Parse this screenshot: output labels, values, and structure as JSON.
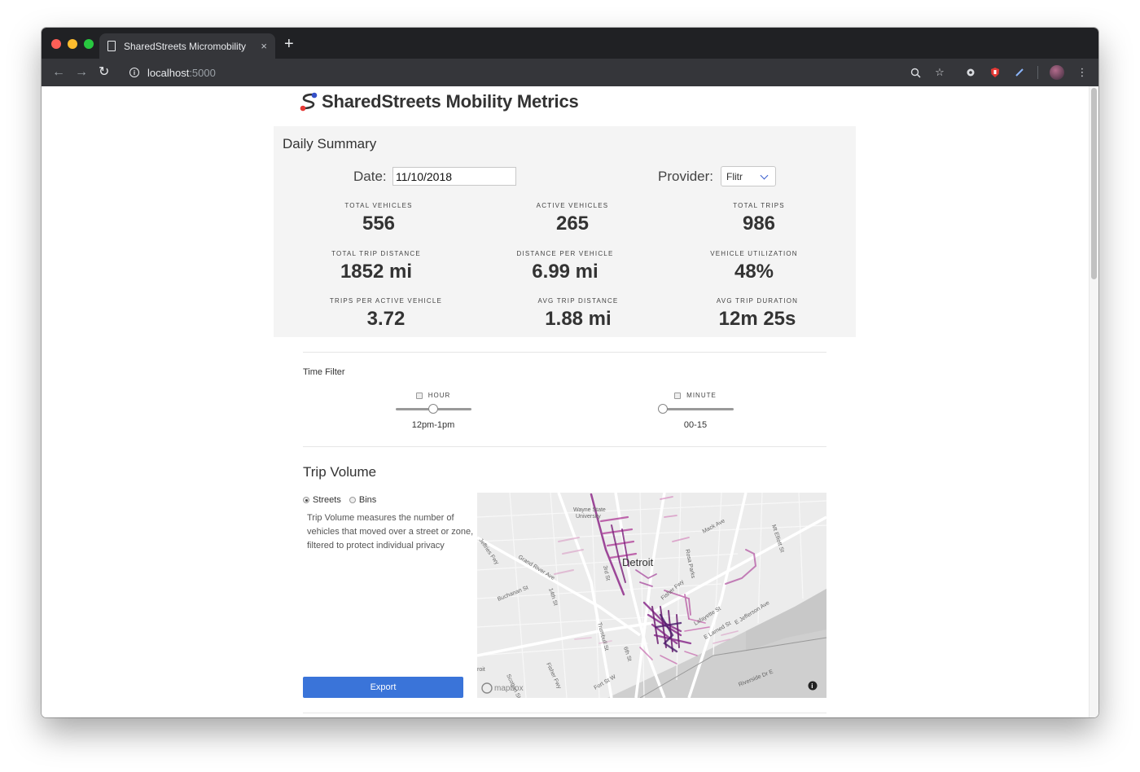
{
  "browser": {
    "tab_title": "SharedStreets Micromobility",
    "tab_close": "×",
    "new_tab": "+",
    "url_host": "localhost",
    "url_port": ":5000"
  },
  "brand": {
    "title": "SharedStreets Mobility Metrics"
  },
  "summary": {
    "title": "Daily Summary",
    "date_label": "Date:",
    "date_value": "11/10/2018",
    "provider_label": "Provider:",
    "provider_value": "Flitr",
    "stats": [
      {
        "label": "Total Vehicles",
        "value": "556"
      },
      {
        "label": "Active Vehicles",
        "value": "265"
      },
      {
        "label": "Total Trips",
        "value": "986"
      },
      {
        "label": "Total Trip Distance",
        "value": "1852 mi"
      },
      {
        "label": "Distance Per Vehicle",
        "value": "6.99 mi"
      },
      {
        "label": "Vehicle Utilization",
        "value": "48%"
      },
      {
        "label": "Trips Per Active Vehicle",
        "value": "3.72"
      },
      {
        "label": "Avg Trip Distance",
        "value": "1.88 mi"
      },
      {
        "label": "Avg Trip Duration",
        "value": "12m 25s"
      }
    ]
  },
  "time_filter": {
    "title": "Time Filter",
    "hour": {
      "label": "HOUR",
      "value": "12pm-1pm",
      "position": 0.5
    },
    "minute": {
      "label": "MINUTE",
      "value": "00-15",
      "position": 0.0
    }
  },
  "trip_volume": {
    "title": "Trip Volume",
    "options": [
      "Streets",
      "Bins"
    ],
    "selected": "Streets",
    "description": "Trip Volume measures the number of vehicles that moved over a street or zone, filtered to protect individual privacy",
    "export_label": "Export"
  },
  "map": {
    "city": "Detroit",
    "labels": [
      "Wayne State",
      "University",
      "Mack Ave",
      "Mt Elliott St",
      "Jeffries Fwy",
      "Grand River Ave",
      "3rd St",
      "Rosa Parks",
      "Buchanan St",
      "14th St",
      "Fisher Fwy",
      "Lafayette St",
      "E Jefferson Ave",
      "E Larned St",
      "Trumbull St",
      "6th St",
      "Fort St W",
      "Riverside Dr E",
      "Fisher Fwy",
      "Scotten St",
      "roit"
    ],
    "attribution": "mapbox",
    "info": "i"
  }
}
